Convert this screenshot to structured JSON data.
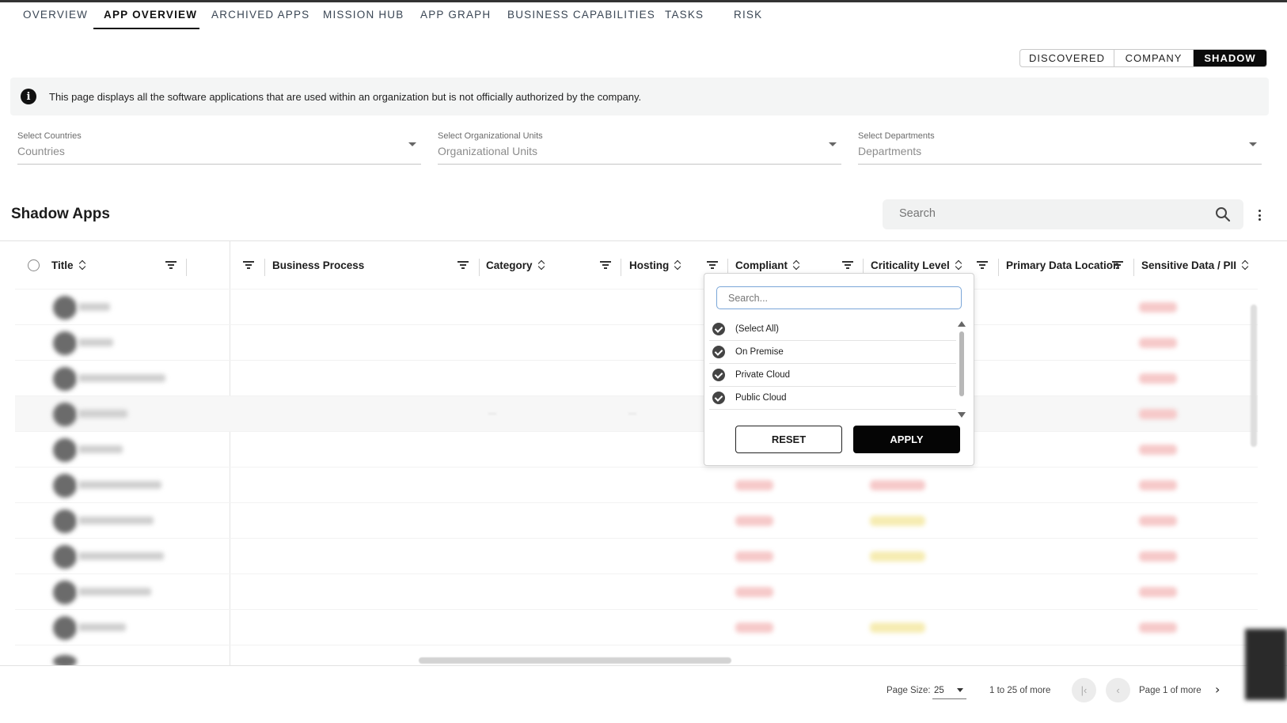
{
  "tabs": [
    {
      "label": "OVERVIEW"
    },
    {
      "label": "APP OVERVIEW"
    },
    {
      "label": "ARCHIVED APPS"
    },
    {
      "label": "MISSION HUB"
    },
    {
      "label": "APP GRAPH"
    },
    {
      "label": "BUSINESS CAPABILITIES"
    },
    {
      "label": "TASKS"
    },
    {
      "label": "RISK"
    }
  ],
  "active_tab": "APP OVERVIEW",
  "view_toggle": {
    "options": [
      "DISCOVERED",
      "COMPANY",
      "SHADOW"
    ],
    "selected": "SHADOW"
  },
  "banner": {
    "icon": "info-icon",
    "text": "This page displays all the software applications that are used within an organization but is not officially authorized by the company."
  },
  "filters": [
    {
      "label": "Select Countries",
      "placeholder": "Countries"
    },
    {
      "label": "Select Organizational Units",
      "placeholder": "Organizational Units"
    },
    {
      "label": "Select Departments",
      "placeholder": "Departments"
    }
  ],
  "section": {
    "title": "Shadow Apps",
    "search_placeholder": "Search"
  },
  "columns": [
    {
      "label": "Title",
      "sortable": true
    },
    {
      "label": "Business Process",
      "sortable": false
    },
    {
      "label": "Category",
      "sortable": true
    },
    {
      "label": "Hosting",
      "sortable": true
    },
    {
      "label": "Compliant",
      "sortable": true
    },
    {
      "label": "Criticality Level",
      "sortable": true
    },
    {
      "label": "Primary Data Location",
      "sortable": false
    },
    {
      "label": "Sensitive Data / PII",
      "sortable": true
    }
  ],
  "hosting_filter": {
    "search_placeholder": "Search...",
    "options": [
      {
        "label": "(Select All)",
        "checked": true
      },
      {
        "label": "On Premise",
        "checked": true
      },
      {
        "label": "Private Cloud",
        "checked": true
      },
      {
        "label": "Public Cloud",
        "checked": true
      }
    ],
    "reset_label": "RESET",
    "apply_label": "APPLY"
  },
  "pagination": {
    "page_size_label": "Page Size:",
    "page_size": "25",
    "range_text": "1 to 25 of more",
    "page_text": "Page 1 of more"
  },
  "colors": {
    "accent": "#050505",
    "banner_bg": "#f4f5f5",
    "search_border": "#7aa6d8",
    "pill_red": "#f6c9c9",
    "pill_yellow": "#f6ecb2"
  }
}
